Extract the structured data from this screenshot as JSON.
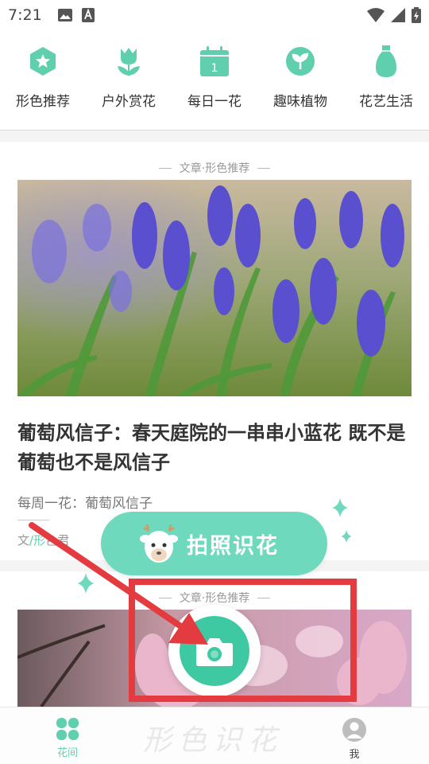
{
  "status_bar": {
    "time": "7:21",
    "left_icons": [
      "image-icon",
      "a-icon"
    ],
    "right_icons": [
      "wifi-icon",
      "signal-icon",
      "battery-icon"
    ]
  },
  "categories": [
    {
      "label": "形色推荐",
      "icon": "star-badge-icon"
    },
    {
      "label": "户外赏花",
      "icon": "tulip-icon"
    },
    {
      "label": "每日一花",
      "icon": "calendar-icon"
    },
    {
      "label": "趣味植物",
      "icon": "sprout-icon"
    },
    {
      "label": "花艺生活",
      "icon": "vase-icon"
    }
  ],
  "articles": [
    {
      "tag": "文章·形色推荐",
      "title": "葡萄风信子：春天庭院的一串串小蓝花 既不是葡萄也不是风信子",
      "subtitle": "每周一花：葡萄风信子",
      "author": "文/形色君"
    },
    {
      "tag": "文章·形色推荐"
    }
  ],
  "photo_button": {
    "label": "拍照识花"
  },
  "tab_bar": {
    "home_label": "花间",
    "me_label": "我",
    "watermark": "形色识花"
  },
  "colors": {
    "accent": "#5fcfae",
    "pill": "#6fd9bd",
    "camera": "#3ec9a2",
    "annotation": "#e33b3f"
  }
}
